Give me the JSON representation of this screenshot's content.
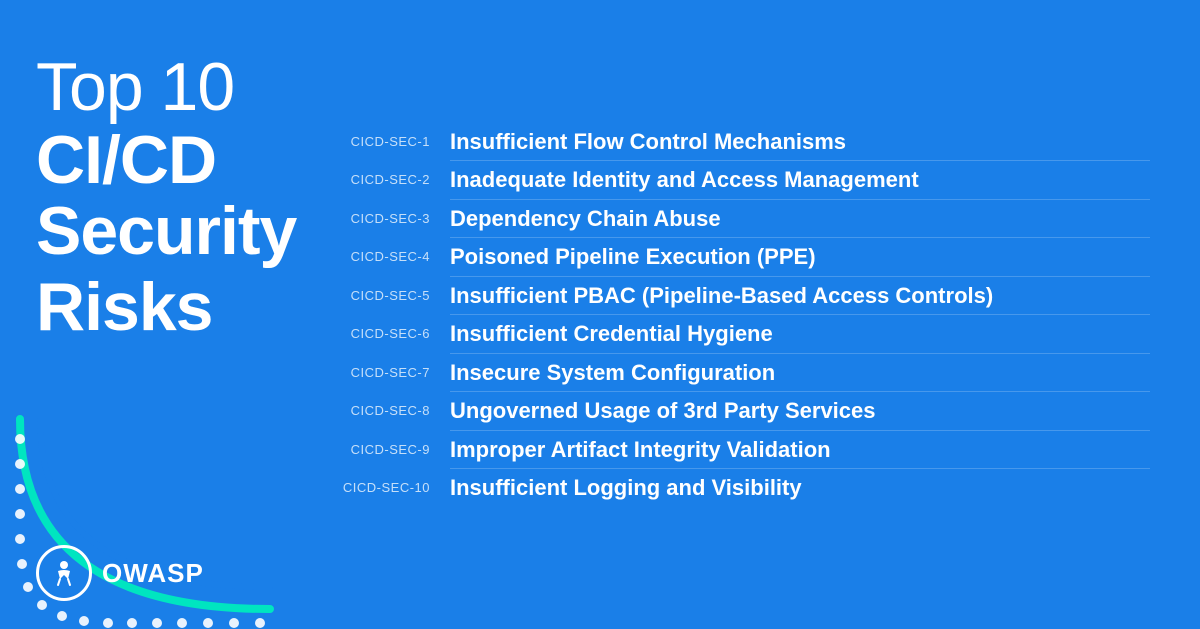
{
  "background_color": "#1a7fe8",
  "left": {
    "title_line1": "Top 10",
    "title_line2": "CI/CD",
    "title_line3": "Security",
    "title_line4": "Risks",
    "owasp_label": "OWASP"
  },
  "risks": [
    {
      "code": "CICD-SEC-1",
      "name": "Insufficient Flow Control Mechanisms"
    },
    {
      "code": "CICD-SEC-2",
      "name": "Inadequate Identity and Access Management"
    },
    {
      "code": "CICD-SEC-3",
      "name": "Dependency Chain Abuse"
    },
    {
      "code": "CICD-SEC-4",
      "name": "Poisoned Pipeline Execution (PPE)"
    },
    {
      "code": "CICD-SEC-5",
      "name": "Insufficient PBAC (Pipeline-Based Access Controls)"
    },
    {
      "code": "CICD-SEC-6",
      "name": "Insufficient Credential Hygiene"
    },
    {
      "code": "CICD-SEC-7",
      "name": "Insecure System Configuration"
    },
    {
      "code": "CICD-SEC-8",
      "name": "Ungoverned Usage of 3rd Party Services"
    },
    {
      "code": "CICD-SEC-9",
      "name": "Improper Artifact Integrity Validation"
    },
    {
      "code": "CICD-SEC-10",
      "name": "Insufficient Logging and Visibility"
    }
  ]
}
